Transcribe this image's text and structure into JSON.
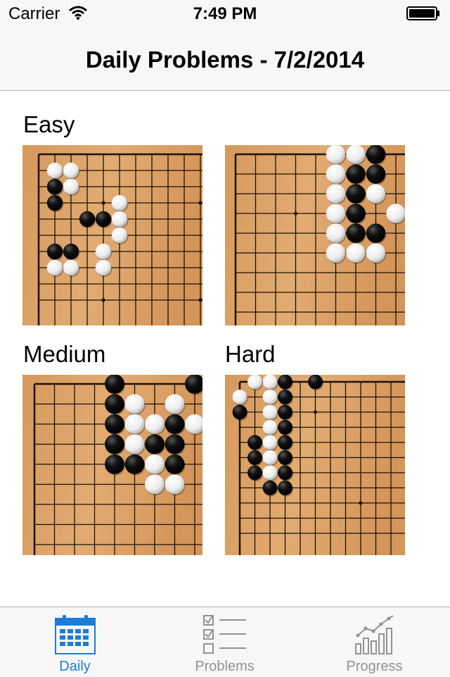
{
  "status_bar": {
    "carrier": "Carrier",
    "time": "7:49 PM",
    "wifi_icon": "wifi-icon",
    "battery_icon": "battery-icon"
  },
  "nav": {
    "title": "Daily Problems - 7/2/2014"
  },
  "sections": [
    {
      "label": "Easy"
    },
    {
      "label": "Medium"
    },
    {
      "label": "Hard"
    }
  ],
  "colors": {
    "board": "#dba167",
    "board_dark": "#c98a4d",
    "active_tab": "#1e7cd8",
    "inactive_tab": "#929292",
    "bar_bg": "#f7f7f7"
  },
  "tabs": [
    {
      "label": "Daily",
      "icon": "calendar-icon",
      "active": true
    },
    {
      "label": "Problems",
      "icon": "checklist-icon",
      "active": false
    },
    {
      "label": "Progress",
      "icon": "bar-chart-icon",
      "active": false
    }
  ],
  "boards": [
    {
      "name": "easy-problem-board-1",
      "difficulty": "Easy",
      "stones": [
        {
          "c": "W",
          "col": 1,
          "row": 1
        },
        {
          "c": "W",
          "col": 2,
          "row": 1
        },
        {
          "c": "B",
          "col": 1,
          "row": 2
        },
        {
          "c": "W",
          "col": 2,
          "row": 2
        },
        {
          "c": "B",
          "col": 1,
          "row": 3
        },
        {
          "c": "W",
          "col": 5,
          "row": 3
        },
        {
          "c": "B",
          "col": 3,
          "row": 4
        },
        {
          "c": "B",
          "col": 4,
          "row": 4
        },
        {
          "c": "W",
          "col": 5,
          "row": 4
        },
        {
          "c": "W",
          "col": 5,
          "row": 5
        },
        {
          "c": "B",
          "col": 1,
          "row": 6
        },
        {
          "c": "B",
          "col": 2,
          "row": 6
        },
        {
          "c": "W",
          "col": 4,
          "row": 6
        },
        {
          "c": "W",
          "col": 1,
          "row": 7
        },
        {
          "c": "W",
          "col": 2,
          "row": 7
        },
        {
          "c": "W",
          "col": 4,
          "row": 7
        }
      ]
    },
    {
      "name": "easy-problem-board-2",
      "difficulty": "Easy",
      "stones": [
        {
          "c": "W",
          "col": 5,
          "row": 0
        },
        {
          "c": "W",
          "col": 6,
          "row": 0
        },
        {
          "c": "B",
          "col": 7,
          "row": 0
        },
        {
          "c": "W",
          "col": 5,
          "row": 1
        },
        {
          "c": "B",
          "col": 6,
          "row": 1
        },
        {
          "c": "B",
          "col": 7,
          "row": 1
        },
        {
          "c": "W",
          "col": 5,
          "row": 2
        },
        {
          "c": "B",
          "col": 6,
          "row": 2
        },
        {
          "c": "W",
          "col": 7,
          "row": 2
        },
        {
          "c": "W",
          "col": 5,
          "row": 3
        },
        {
          "c": "B",
          "col": 6,
          "row": 3
        },
        {
          "c": "W",
          "col": 8,
          "row": 3
        },
        {
          "c": "W",
          "col": 5,
          "row": 4
        },
        {
          "c": "B",
          "col": 6,
          "row": 4
        },
        {
          "c": "B",
          "col": 7,
          "row": 4
        },
        {
          "c": "W",
          "col": 5,
          "row": 5
        },
        {
          "c": "W",
          "col": 6,
          "row": 5
        },
        {
          "c": "W",
          "col": 7,
          "row": 5
        }
      ]
    },
    {
      "name": "medium-problem-board",
      "difficulty": "Medium",
      "stones": [
        {
          "c": "B",
          "col": 4,
          "row": 0
        },
        {
          "c": "B",
          "col": 8,
          "row": 0
        },
        {
          "c": "B",
          "col": 4,
          "row": 1
        },
        {
          "c": "W",
          "col": 5,
          "row": 1
        },
        {
          "c": "W",
          "col": 7,
          "row": 1
        },
        {
          "c": "B",
          "col": 4,
          "row": 2
        },
        {
          "c": "W",
          "col": 5,
          "row": 2
        },
        {
          "c": "W",
          "col": 6,
          "row": 2
        },
        {
          "c": "B",
          "col": 7,
          "row": 2
        },
        {
          "c": "W",
          "col": 8,
          "row": 2
        },
        {
          "c": "B",
          "col": 4,
          "row": 3
        },
        {
          "c": "W",
          "col": 5,
          "row": 3
        },
        {
          "c": "B",
          "col": 6,
          "row": 3
        },
        {
          "c": "B",
          "col": 7,
          "row": 3
        },
        {
          "c": "B",
          "col": 4,
          "row": 4
        },
        {
          "c": "B",
          "col": 5,
          "row": 4
        },
        {
          "c": "W",
          "col": 6,
          "row": 4
        },
        {
          "c": "B",
          "col": 7,
          "row": 4
        },
        {
          "c": "W",
          "col": 6,
          "row": 5
        },
        {
          "c": "W",
          "col": 7,
          "row": 5
        }
      ]
    },
    {
      "name": "hard-problem-board",
      "difficulty": "Hard",
      "stones": [
        {
          "c": "W",
          "col": 1,
          "row": 0
        },
        {
          "c": "W",
          "col": 2,
          "row": 0
        },
        {
          "c": "B",
          "col": 3,
          "row": 0
        },
        {
          "c": "B",
          "col": 5,
          "row": 0
        },
        {
          "c": "W",
          "col": 0,
          "row": 1
        },
        {
          "c": "W",
          "col": 2,
          "row": 1
        },
        {
          "c": "B",
          "col": 3,
          "row": 1
        },
        {
          "c": "B",
          "col": 0,
          "row": 2
        },
        {
          "c": "W",
          "col": 2,
          "row": 2
        },
        {
          "c": "B",
          "col": 3,
          "row": 2
        },
        {
          "c": "W",
          "col": 2,
          "row": 3
        },
        {
          "c": "B",
          "col": 3,
          "row": 3
        },
        {
          "c": "B",
          "col": 1,
          "row": 4
        },
        {
          "c": "W",
          "col": 2,
          "row": 4
        },
        {
          "c": "B",
          "col": 3,
          "row": 4
        },
        {
          "c": "B",
          "col": 1,
          "row": 5
        },
        {
          "c": "W",
          "col": 2,
          "row": 5
        },
        {
          "c": "B",
          "col": 3,
          "row": 5
        },
        {
          "c": "B",
          "col": 1,
          "row": 6
        },
        {
          "c": "W",
          "col": 2,
          "row": 6
        },
        {
          "c": "B",
          "col": 3,
          "row": 6
        },
        {
          "c": "B",
          "col": 2,
          "row": 7
        },
        {
          "c": "B",
          "col": 3,
          "row": 7
        }
      ]
    }
  ]
}
